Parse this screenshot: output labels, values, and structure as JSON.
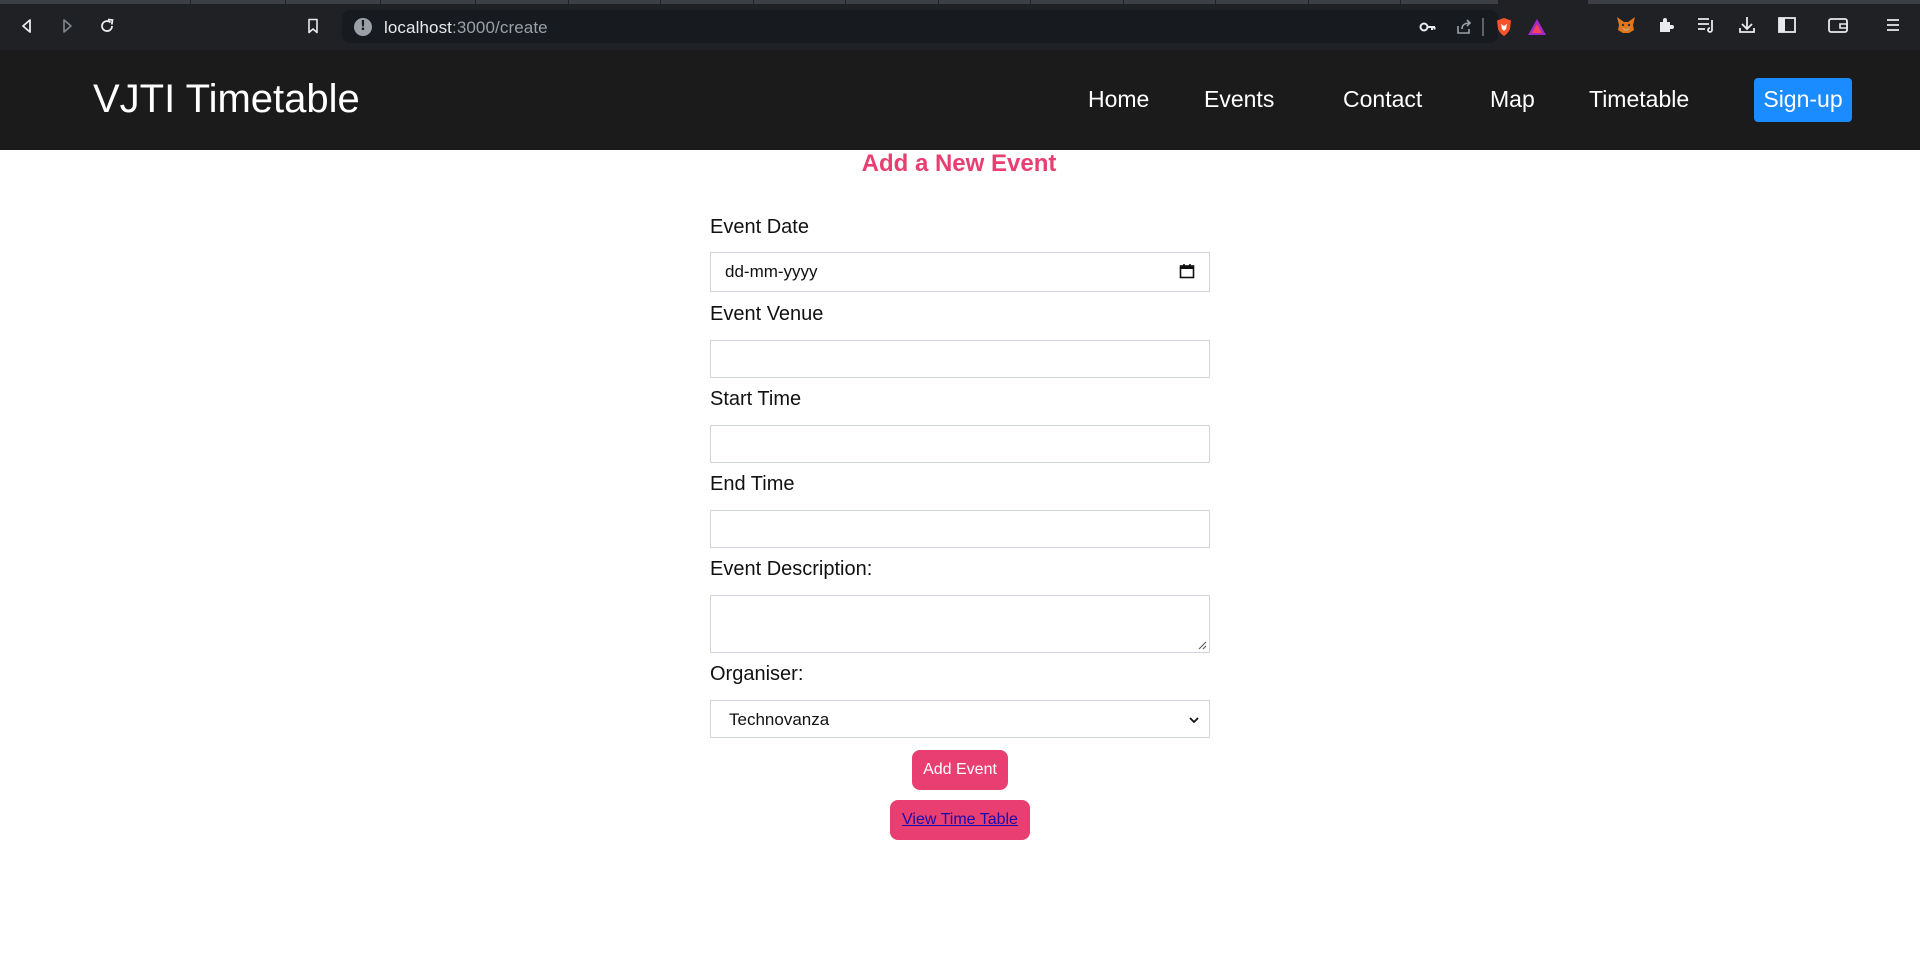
{
  "browser": {
    "url_host": "localhost",
    "url_path": ":3000/create",
    "icons": [
      "back-icon",
      "forward-icon",
      "reload-icon",
      "bookmark-icon",
      "site-info-icon",
      "key-icon",
      "share-icon",
      "brave-shield-icon",
      "brave-rewards-icon",
      "metamask-fox-icon",
      "extensions-icon",
      "playlist-icon",
      "download-icon",
      "sidebar-icon",
      "wallet-icon",
      "menu-icon"
    ]
  },
  "navbar": {
    "brand": "VJTI Timetable",
    "links": [
      "Home",
      "Events",
      "Contact",
      "Map",
      "Timetable"
    ],
    "signup": "Sign-up"
  },
  "form": {
    "heading": "Add a New Event",
    "event_date_label": "Event Date",
    "event_date_placeholder": "dd-mm-yyyy",
    "event_venue_label": "Event Venue",
    "start_time_label": "Start Time",
    "end_time_label": "End Time",
    "description_label": "Event Description:",
    "organiser_label": "Organiser:",
    "organiser_selected": "Technovanza",
    "add_button": "Add Event",
    "view_link": "View Time Table"
  },
  "colors": {
    "accent": "#e83e72",
    "navbar_bg": "#1b1b1b",
    "signup_bg": "#1a8cff",
    "link": "#1a0dab"
  }
}
